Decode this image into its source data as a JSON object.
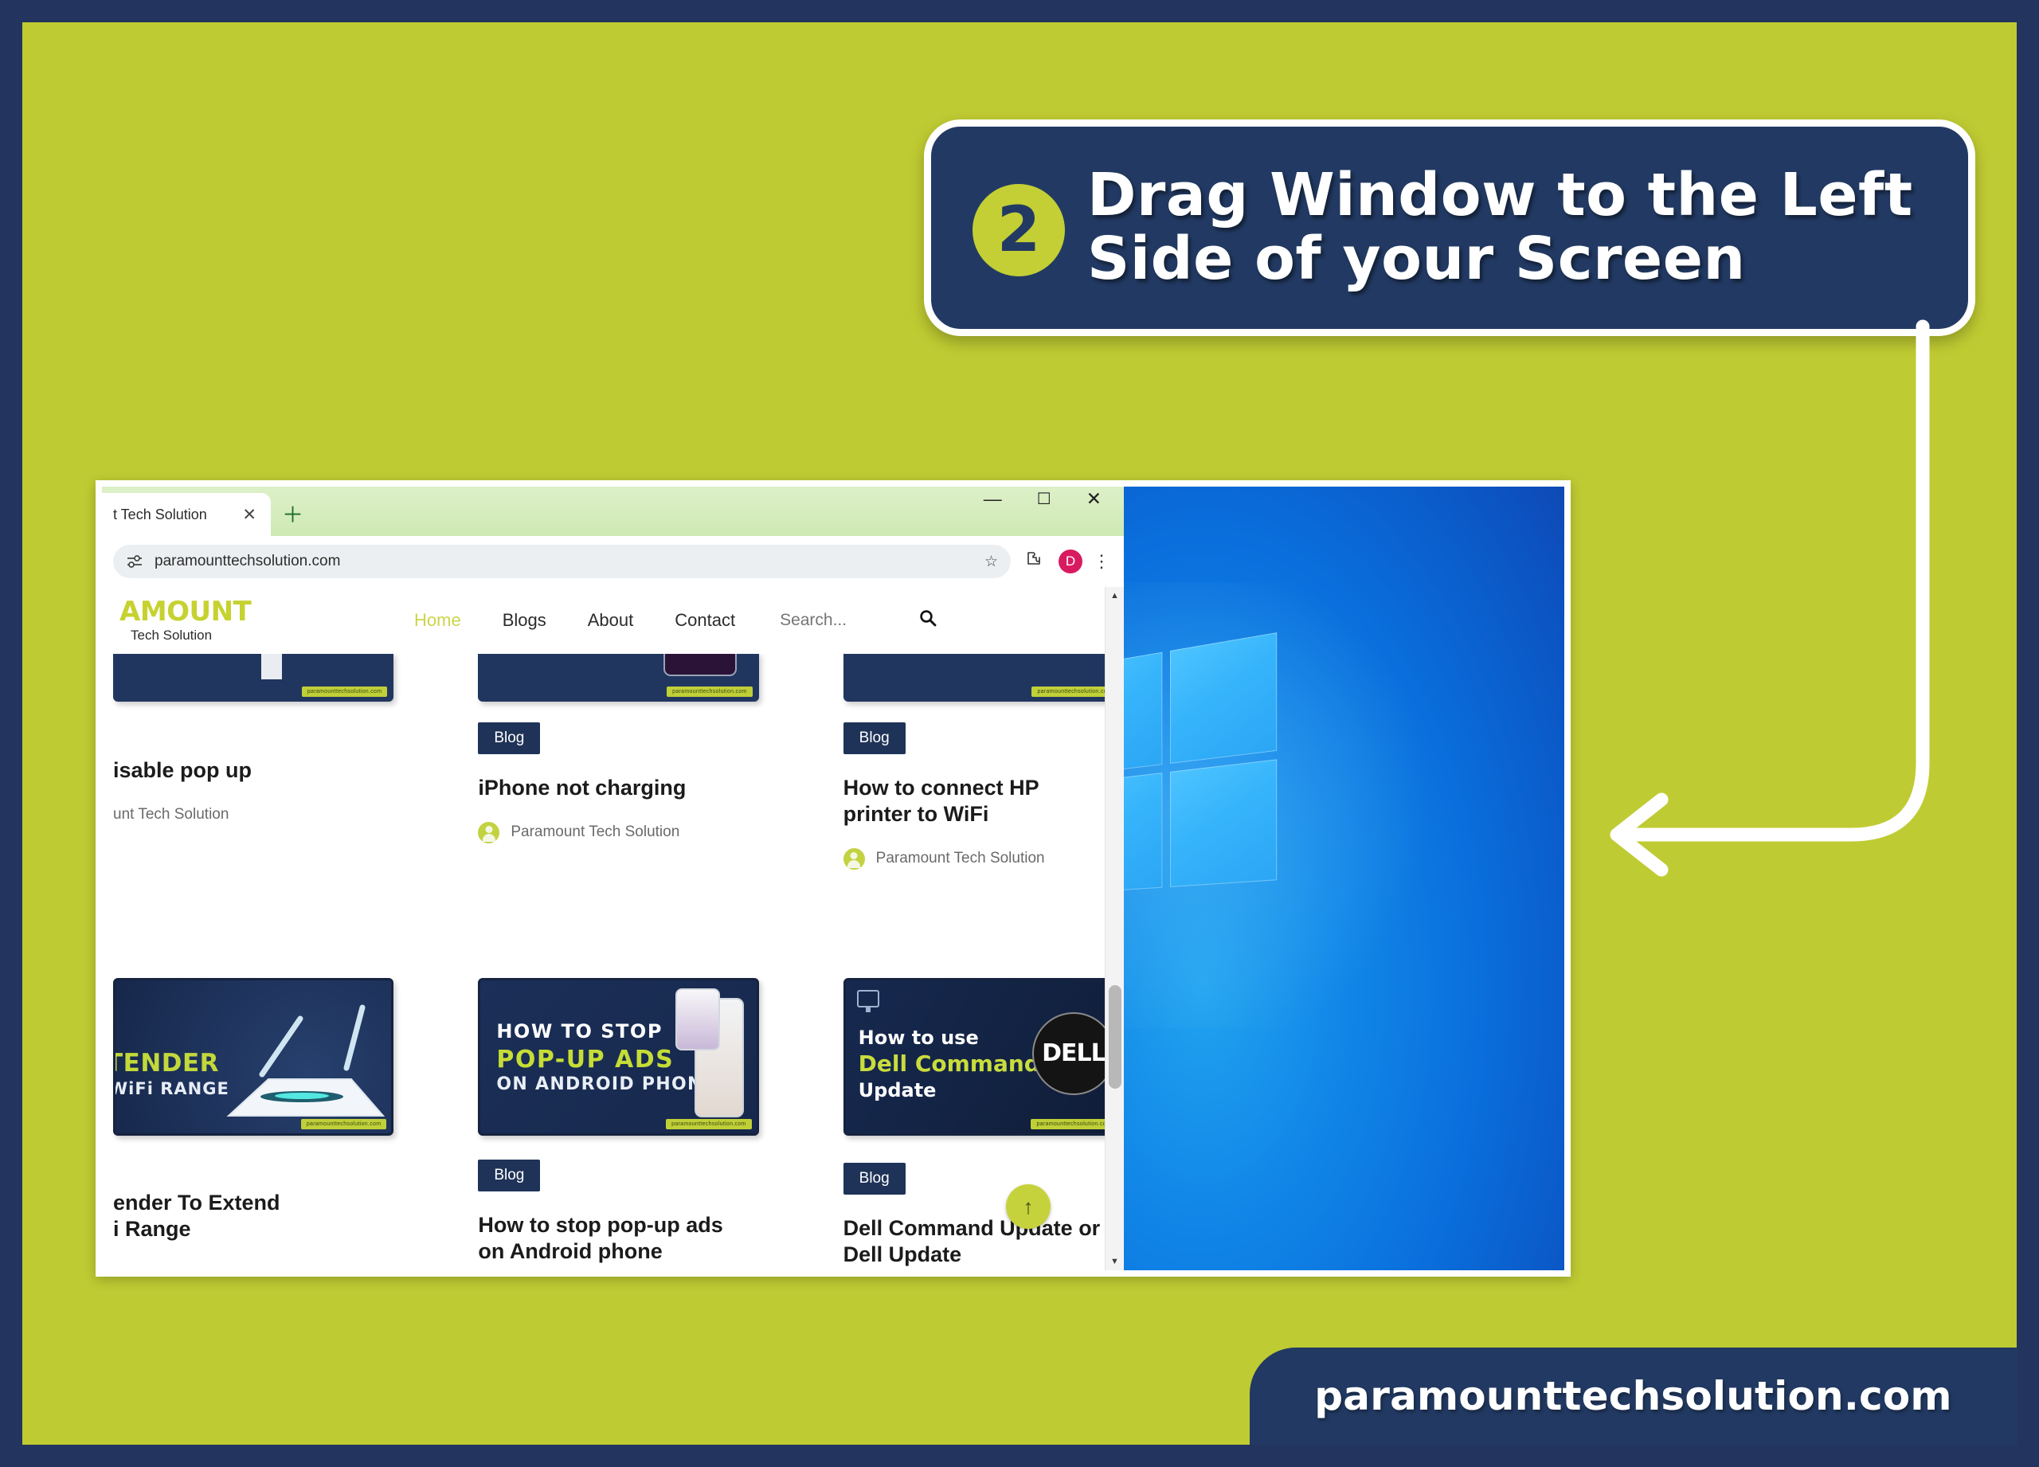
{
  "theme": {
    "page_bg": "#bfcb32",
    "frame_border": "#23355e",
    "navy": "#223a63",
    "accent_green": "#c6d23c",
    "white": "#ffffff"
  },
  "banner": {
    "step_number": "2",
    "line1": "Drag Window to the Left",
    "line2": "Side of your Screen"
  },
  "arrow": {
    "name": "curved-left-arrow"
  },
  "browser": {
    "tab": {
      "title": "t Tech Solution",
      "close_label": "✕"
    },
    "new_tab_label": "＋",
    "window_controls": {
      "minimize": "—",
      "maximize": "☐",
      "close": "✕"
    },
    "omnibox": {
      "url": "paramounttechsolution.com",
      "site_icon": "tune-icon",
      "bookmark_star": "☆"
    },
    "toolbar": {
      "extensions_icon": "puzzle-icon",
      "avatar_letter": "D",
      "menu_icon": "⋮"
    }
  },
  "site": {
    "logo": {
      "main": "AMOUNT",
      "sub": "Tech Solution"
    },
    "nav": [
      {
        "label": "Home",
        "active": true
      },
      {
        "label": "Blogs",
        "active": false
      },
      {
        "label": "About",
        "active": false
      },
      {
        "label": "Contact",
        "active": false
      }
    ],
    "search": {
      "placeholder": "Search...",
      "value": "",
      "button_icon": "search-icon"
    },
    "scroll_top_button": "↑",
    "cards_row1": [
      {
        "thumb_watermark": "paramounttechsolution.com",
        "chip": "",
        "title": "isable pop up",
        "author": "unt Tech Solution",
        "show_chip": false
      },
      {
        "thumb_watermark": "paramounttechsolution.com",
        "chip": "Blog",
        "title": "iPhone not charging",
        "author": "Paramount Tech Solution",
        "show_chip": true
      },
      {
        "thumb_watermark": "paramounttechsolution.com",
        "chip": "Blog",
        "title": "How to connect HP printer to WiFi",
        "author": "Paramount Tech Solution",
        "show_chip": true
      }
    ],
    "cards_row2": [
      {
        "art_line1": "TENDER",
        "art_line2": "WiFi RANGE",
        "chip": "",
        "title": "ender To Extend\ni Range",
        "show_chip": false
      },
      {
        "art_line1": "HOW TO STOP",
        "art_line2": "POP-UP ADS",
        "art_line3": "ON ANDROID PHONE",
        "chip": "Blog",
        "title": "How to stop pop-up ads\non Android phone",
        "show_chip": true
      },
      {
        "art_line1": "How to use",
        "art_line2": "Dell Command",
        "art_line3": "Update",
        "art_logo": "DELL",
        "chip": "Blog",
        "title": "Dell Command Update or\nDell Update",
        "show_chip": true
      }
    ]
  },
  "desktop": {
    "name": "windows-10-wallpaper"
  },
  "footer": {
    "text": "paramounttechsolution.com"
  }
}
